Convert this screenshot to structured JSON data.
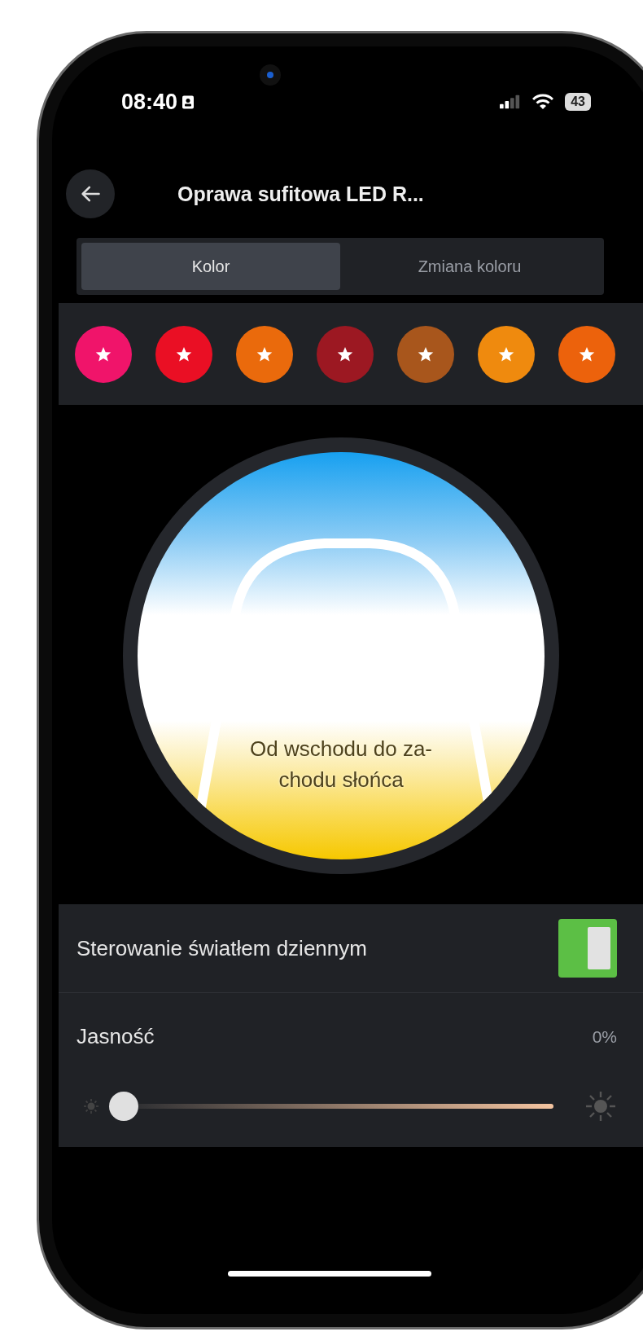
{
  "status_bar": {
    "time": "08:40",
    "battery": "43"
  },
  "header": {
    "title": "Oprawa sufitowa LED R..."
  },
  "tabs": [
    {
      "label": "Kolor",
      "selected": true
    },
    {
      "label": "Zmiana koloru",
      "selected": false
    }
  ],
  "swatches": [
    {
      "color": "#f0146a"
    },
    {
      "color": "#ea0f24"
    },
    {
      "color": "#ea6a0c"
    },
    {
      "color": "#9c1822"
    },
    {
      "color": "#a8561c"
    },
    {
      "color": "#ef8a0e"
    },
    {
      "color": "#ec620c"
    }
  ],
  "scene": {
    "label": "Od wschodu do za-\nchodu słońca"
  },
  "daylight": {
    "label": "Sterowanie światłem dziennym",
    "on": true
  },
  "brightness": {
    "label": "Jasność",
    "reading": "0%",
    "level": 0
  }
}
